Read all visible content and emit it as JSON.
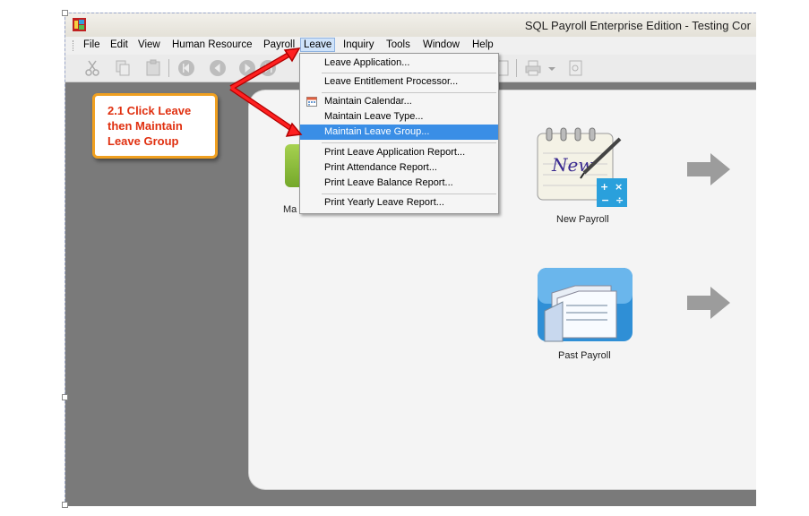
{
  "window": {
    "title": "SQL Payroll Enterprise Edition - Testing Cor"
  },
  "menubar": {
    "items": [
      {
        "label": "File",
        "active": false
      },
      {
        "label": "Edit",
        "active": false
      },
      {
        "label": "View",
        "active": false
      },
      {
        "label": "Human Resource",
        "active": false
      },
      {
        "label": "Payroll",
        "active": false
      },
      {
        "label": "Leave",
        "active": true
      },
      {
        "label": "Inquiry",
        "active": false
      },
      {
        "label": "Tools",
        "active": false
      },
      {
        "label": "Window",
        "active": false
      },
      {
        "label": "Help",
        "active": false
      }
    ]
  },
  "leave_menu": {
    "items": [
      {
        "label": "Leave Application...",
        "icon": null,
        "highlighted": false
      },
      {
        "label": "Leave Entitlement Processor...",
        "icon": null,
        "highlighted": false
      },
      {
        "label": "Maintain Calendar...",
        "icon": "calendar-icon",
        "highlighted": false
      },
      {
        "label": "Maintain Leave Type...",
        "icon": null,
        "highlighted": false
      },
      {
        "label": "Maintain Leave Group...",
        "icon": null,
        "highlighted": true
      },
      {
        "label": "Print Leave Application Report...",
        "icon": null,
        "highlighted": false
      },
      {
        "label": "Print Attendance Report...",
        "icon": null,
        "highlighted": false
      },
      {
        "label": "Print Leave Balance Report...",
        "icon": null,
        "highlighted": false
      },
      {
        "label": "Print Yearly Leave Report...",
        "icon": null,
        "highlighted": false
      }
    ]
  },
  "main": {
    "tiles": [
      {
        "label": "New Payroll",
        "icon": "new-payroll-icon"
      },
      {
        "label": "Past Payroll",
        "icon": "past-payroll-icon"
      },
      {
        "label": "Ma",
        "icon": "maintain-icon"
      }
    ]
  },
  "callout": {
    "lines": [
      "2.1 Click Leave",
      "then Maintain",
      "Leave Group"
    ]
  },
  "colors": {
    "highlight": "#3a8ee6",
    "callout_text": "#e03010",
    "callout_border": "#f0a020",
    "pointer_arrow": "#e01010"
  }
}
